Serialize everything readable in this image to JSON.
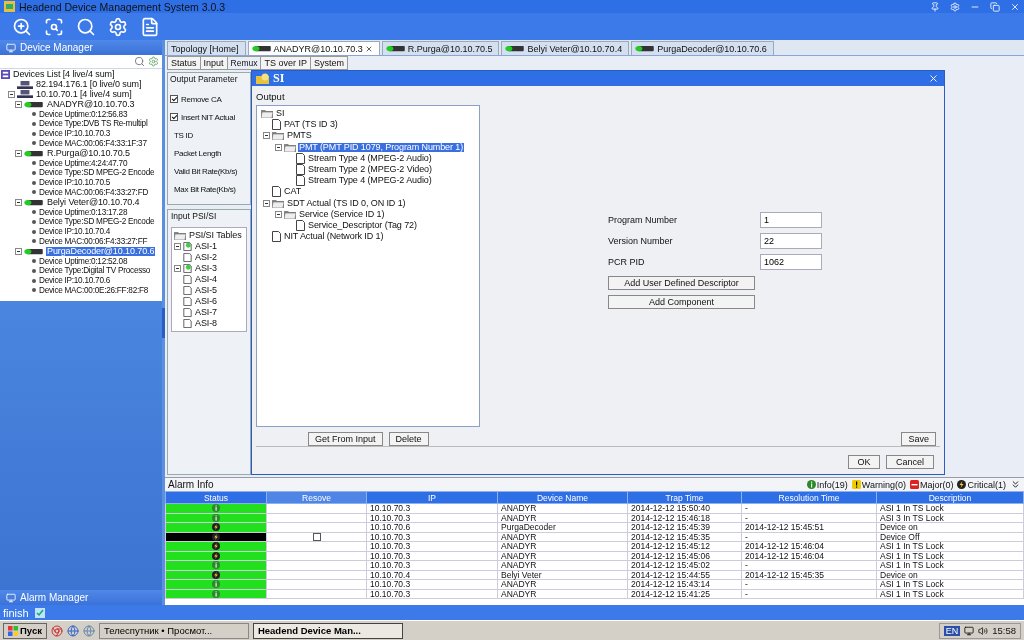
{
  "window": {
    "title": "Headend Device Management System 3.0.3"
  },
  "device_manager": {
    "title": "Device Manager",
    "tree": [
      {
        "label": "Devices List [4 live/4 sum]",
        "kind": "root",
        "selected": false,
        "children": [
          {
            "label": "82.194.176.1 [0 live/0 sum]",
            "kind": "network",
            "selected": false
          },
          {
            "label": "10.10.70.1 [4 live/4 sum]",
            "kind": "network",
            "selected": false,
            "children": [
              {
                "label": "ANADYR@10.10.70.3",
                "kind": "device",
                "selected": false,
                "children": [
                  {
                    "label": "Device Uptime:0:12:56.83",
                    "kind": "info",
                    "selected": false
                  },
                  {
                    "label": "Device Type:DVB TS Re-multipl",
                    "kind": "info",
                    "selected": false
                  },
                  {
                    "label": "Device IP:10.10.70.3",
                    "kind": "info",
                    "selected": false
                  },
                  {
                    "label": "Device MAC:00:06:F4:33:1F:37",
                    "kind": "info",
                    "selected": false
                  }
                ]
              },
              {
                "label": "R.Purga@10.10.70.5",
                "kind": "device",
                "selected": false,
                "children": [
                  {
                    "label": "Device Uptime:4:24:47.70",
                    "kind": "info",
                    "selected": false
                  },
                  {
                    "label": "Device Type:SD MPEG-2 Encode",
                    "kind": "info",
                    "selected": false
                  },
                  {
                    "label": "Device IP:10.10.70.5",
                    "kind": "info",
                    "selected": false
                  },
                  {
                    "label": "Device MAC:00:06:F4:33:27:FD",
                    "kind": "info",
                    "selected": false
                  }
                ]
              },
              {
                "label": "Belyi Veter@10.10.70.4",
                "kind": "device",
                "selected": false,
                "children": [
                  {
                    "label": "Device Uptime:0:13:17.28",
                    "kind": "info",
                    "selected": false
                  },
                  {
                    "label": "Device Type:SD MPEG-2 Encode",
                    "kind": "info",
                    "selected": false
                  },
                  {
                    "label": "Device IP:10.10.70.4",
                    "kind": "info",
                    "selected": false
                  },
                  {
                    "label": "Device MAC:00:06:F4:33:27:FF",
                    "kind": "info",
                    "selected": false
                  }
                ]
              },
              {
                "label": "PurgaDecoder@10.10.70.6",
                "kind": "device",
                "selected": true,
                "children": [
                  {
                    "label": "Device Uptime:0:12:52.08",
                    "kind": "info",
                    "selected": false
                  },
                  {
                    "label": "Device Type:Digital TV Processo",
                    "kind": "info",
                    "selected": false
                  },
                  {
                    "label": "Device IP:10.10.70.6",
                    "kind": "info",
                    "selected": false
                  },
                  {
                    "label": "Device MAC:00:0E:26:FF:82:F8",
                    "kind": "info",
                    "selected": false
                  }
                ]
              }
            ]
          }
        ]
      }
    ]
  },
  "alarm_manager": {
    "title": "Alarm Manager"
  },
  "device_tabs": [
    {
      "label": "Topology [Home]",
      "kind": "home",
      "selected": false
    },
    {
      "label": "ANADYR@10.10.70.3",
      "kind": "device",
      "selected": true
    },
    {
      "label": "R.Purga@10.10.70.5",
      "kind": "device",
      "selected": false
    },
    {
      "label": "Belyi Veter@10.10.70.4",
      "kind": "device",
      "selected": false
    },
    {
      "label": "PurgaDecoder@10.10.70.6",
      "kind": "device",
      "selected": false
    }
  ],
  "sub_tabs": [
    {
      "label": "Status",
      "selected": false
    },
    {
      "label": "Input",
      "selected": false
    },
    {
      "label": "Remux",
      "selected": true
    },
    {
      "label": "TS over IP",
      "selected": false
    },
    {
      "label": "System",
      "selected": false
    }
  ],
  "output_parameter": {
    "title": "Output Parameter",
    "checks": [
      {
        "label": "Remove CA",
        "checked": true
      },
      {
        "label": "Insert NIT Actual",
        "checked": true
      }
    ],
    "fields": [
      "TS ID",
      "Packet Length",
      "Valid Bit Rate(Kb/s)",
      "Max Bit Rate(Kb/s)"
    ]
  },
  "input_psi_si": {
    "title": "Input PSI/SI",
    "tree": [
      {
        "label": "PSI/SI Tables",
        "kind": "tables",
        "children": [
          {
            "label": "ASI-1",
            "kind": "live",
            "expandable": true
          },
          {
            "label": "ASI-2",
            "kind": "plain",
            "expandable": false
          },
          {
            "label": "ASI-3",
            "kind": "live",
            "expandable": true
          },
          {
            "label": "ASI-4",
            "kind": "plain",
            "expandable": false
          },
          {
            "label": "ASI-5",
            "kind": "plain",
            "expandable": false
          },
          {
            "label": "ASI-6",
            "kind": "plain",
            "expandable": false
          },
          {
            "label": "ASI-7",
            "kind": "plain",
            "expandable": false
          },
          {
            "label": "ASI-8",
            "kind": "plain",
            "expandable": false
          }
        ]
      }
    ]
  },
  "si_dialog": {
    "title": "SI",
    "output_label": "Output",
    "tree": [
      {
        "label": "SI",
        "kind": "folder",
        "selected": false,
        "children": [
          {
            "label": "PAT (TS ID 3)",
            "kind": "doc",
            "selected": false
          },
          {
            "label": "PMTS",
            "kind": "folder",
            "selected": false,
            "children": [
              {
                "label": "PMT (PMT PID 1079, Program Number 1)",
                "kind": "folder",
                "selected": true,
                "children": [
                  {
                    "label": "Stream Type 4 (MPEG-2 Audio)",
                    "kind": "doc",
                    "selected": false
                  },
                  {
                    "label": "Stream Type 2 (MPEG-2 Video)",
                    "kind": "doc",
                    "selected": false
                  },
                  {
                    "label": "Stream Type 4 (MPEG-2 Audio)",
                    "kind": "doc",
                    "selected": false
                  }
                ]
              }
            ]
          },
          {
            "label": "CAT",
            "kind": "doc",
            "selected": false
          },
          {
            "label": "SDT Actual (TS ID 0, ON ID 1)",
            "kind": "folder",
            "selected": false,
            "children": [
              {
                "label": "Service (Service ID 1)",
                "kind": "folder",
                "selected": false,
                "children": [
                  {
                    "label": "Service_Descriptor (Tag 72)",
                    "kind": "doc",
                    "selected": false
                  }
                ]
              }
            ]
          },
          {
            "label": "NIT Actual (Network ID 1)",
            "kind": "doc",
            "selected": false
          }
        ]
      }
    ],
    "fields": [
      {
        "label": "Program Number",
        "value": "1"
      },
      {
        "label": "Version Number",
        "value": "22"
      },
      {
        "label": "PCR PID",
        "value": "1062"
      }
    ],
    "form_buttons": [
      "Add User Defined Descriptor",
      "Add Component"
    ],
    "tree_buttons": [
      "Get From Input",
      "Delete"
    ],
    "save": "Save",
    "ok": "OK",
    "cancel": "Cancel"
  },
  "alarm_info": {
    "title": "Alarm Info",
    "legend": [
      {
        "label": "Info(19)",
        "kind": "info"
      },
      {
        "label": "Warning(0)",
        "kind": "warning"
      },
      {
        "label": "Major(0)",
        "kind": "major"
      },
      {
        "label": "Critical(1)",
        "kind": "critical"
      }
    ],
    "columns": [
      "Status",
      "Resove",
      "IP",
      "Device Name",
      "Trap Time",
      "Resolution Time",
      "Description"
    ],
    "rows": [
      {
        "kind": "info",
        "color": "#22e01e",
        "ip": "10.10.70.3",
        "device": "ANADYR",
        "trap": "2014-12-12 15:50:40",
        "resolution": "-",
        "description": "ASI 1 In TS Lock"
      },
      {
        "kind": "info",
        "color": "#22e01e",
        "ip": "10.10.70.3",
        "device": "ANADYR",
        "trap": "2014-12-12 15:46:18",
        "resolution": "-",
        "description": "ASI 3 In TS Lock"
      },
      {
        "kind": "critical",
        "color": "#22e01e",
        "ip": "10.10.70.6",
        "device": "PurgaDecoder",
        "trap": "2014-12-12 15:45:39",
        "resolution": "2014-12-12 15:45:51",
        "description": "Device on"
      },
      {
        "kind": "critical",
        "color": "#000000",
        "resolve": {
          "checked": false
        },
        "ip": "10.10.70.3",
        "device": "ANADYR",
        "trap": "2014-12-12 15:45:35",
        "resolution": "-",
        "description": "Device Off"
      },
      {
        "kind": "critical",
        "color": "#22e01e",
        "ip": "10.10.70.3",
        "device": "ANADYR",
        "trap": "2014-12-12 15:45:12",
        "resolution": "2014-12-12 15:46:04",
        "description": "ASI 1 In TS Lock"
      },
      {
        "kind": "critical",
        "color": "#22e01e",
        "ip": "10.10.70.3",
        "device": "ANADYR",
        "trap": "2014-12-12 15:45:06",
        "resolution": "2014-12-12 15:46:04",
        "description": "ASI 1 In TS Lock"
      },
      {
        "kind": "info",
        "color": "#22e01e",
        "ip": "10.10.70.3",
        "device": "ANADYR",
        "trap": "2014-12-12 15:45:02",
        "resolution": "-",
        "description": "ASI 1 In TS Lock"
      },
      {
        "kind": "critical",
        "color": "#22e01e",
        "ip": "10.10.70.4",
        "device": "Belyi Veter",
        "trap": "2014-12-12 15:44:55",
        "resolution": "2014-12-12 15:45:35",
        "description": "Device on"
      },
      {
        "kind": "info",
        "color": "#22e01e",
        "ip": "10.10.70.3",
        "device": "ANADYR",
        "trap": "2014-12-12 15:43:14",
        "resolution": "-",
        "description": "ASI 1 In TS Lock"
      },
      {
        "kind": "info",
        "color": "#22e01e",
        "ip": "10.10.70.3",
        "device": "ANADYR",
        "trap": "2014-12-12 15:41:25",
        "resolution": "-",
        "description": "ASI 1 In TS Lock"
      }
    ]
  },
  "status_bar": {
    "text": "finish"
  },
  "taskbar": {
    "start": "Пуск",
    "tasks": [
      {
        "label": "Телеспутник • Просмот...",
        "selected": false
      },
      {
        "label": "Headend Device Man...",
        "selected": true
      }
    ],
    "language": "EN",
    "clock": "15:58"
  }
}
